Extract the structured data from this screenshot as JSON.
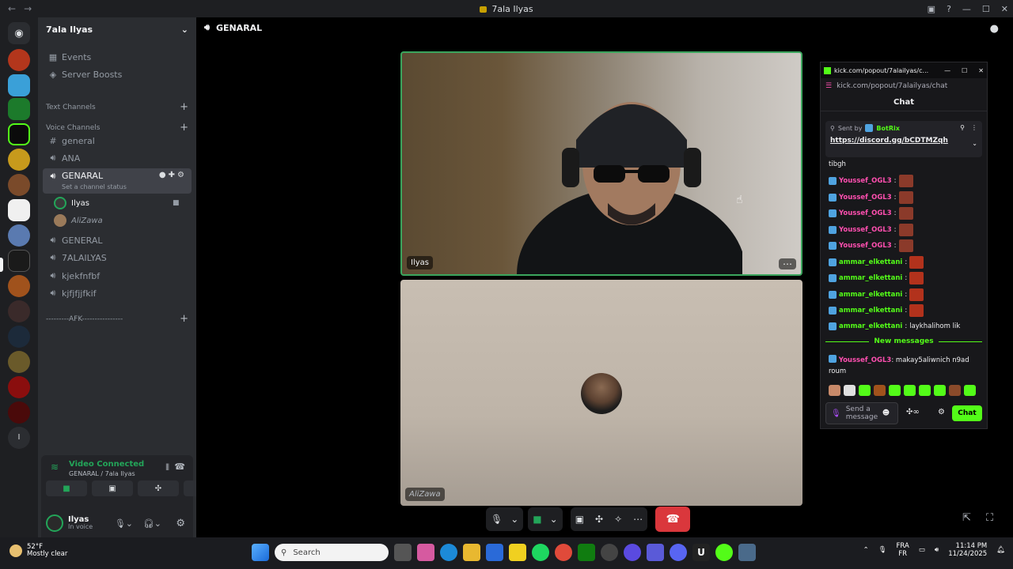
{
  "window": {
    "title": "7ala Ilyas",
    "back": "←",
    "forward": "→"
  },
  "server_name": "7ala Ilyas",
  "sidebar": {
    "events": "Events",
    "boosts": "Server Boosts",
    "text_channels": "Text Channels",
    "voice_channels": "Voice Channels",
    "channels": [
      {
        "name": "general",
        "icon": "#"
      },
      {
        "name": "ANA",
        "icon": "speaker"
      },
      {
        "name": "GENARAL",
        "icon": "speaker",
        "active": true
      }
    ],
    "status_hint": "Set a channel status",
    "users_in_channel": [
      "Ilyas",
      "AliZawa"
    ],
    "more_channels": [
      "GENERAL",
      "7ALAILYAS",
      "kjekfnfbf",
      "kjfjfjjfkif"
    ],
    "afk": "---------AFK----------------"
  },
  "voice_panel": {
    "status": "Video Connected",
    "location": "GENARAL / 7ala Ilyas",
    "username": "Ilyas",
    "user_status": "In voice",
    "brand_colors": {
      "connected": "#23a559"
    }
  },
  "main": {
    "channel": "GENARAL",
    "tile1_name": "Ilyas",
    "tile2_name": "AliZawa",
    "more": "⋯"
  },
  "kick": {
    "tab_title": "kick.com/popout/7alailyas/c...",
    "url": "kick.com/popout/7alailyas/chat",
    "header": "Chat",
    "pinned_sent_by": "Sent by",
    "pinned_bot": "BotRix",
    "pinned_link": "https://discord.gg/bCDTMZqh",
    "prev_text": "tibgh",
    "messages": [
      {
        "user": "Youssef_OGL3",
        "color": "pink",
        "text": ""
      },
      {
        "user": "Youssef_OGL3",
        "color": "pink",
        "text": ""
      },
      {
        "user": "Youssef_OGL3",
        "color": "pink",
        "text": ""
      },
      {
        "user": "Youssef_OGL3",
        "color": "pink",
        "text": ""
      },
      {
        "user": "Youssef_OGL3",
        "color": "pink",
        "text": ""
      },
      {
        "user": "ammar_elkettani",
        "color": "green",
        "text": ""
      },
      {
        "user": "ammar_elkettani",
        "color": "green",
        "text": ""
      },
      {
        "user": "ammar_elkettani",
        "color": "green",
        "text": ""
      },
      {
        "user": "ammar_elkettani",
        "color": "green",
        "text": ""
      },
      {
        "user": "ammar_elkettani",
        "color": "green",
        "text": "laykhalihom lik"
      }
    ],
    "new_messages": "New messages",
    "last_user": "Youssef_OGL3",
    "last_text": "makay5aliwnich n9ad roum",
    "input_placeholder": "Send a message",
    "chat_button": "Chat"
  },
  "taskbar": {
    "temp": "52°F",
    "weather": "Mostly clear",
    "search": "Search",
    "lang1": "FRA",
    "lang2": "FR",
    "time": "11:14 PM",
    "date": "11/24/2025"
  }
}
